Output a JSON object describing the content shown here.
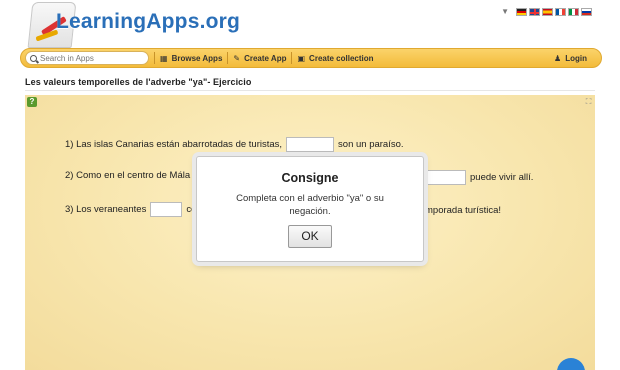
{
  "header": {
    "logo_text": "LearningApps.org",
    "languages": [
      "de",
      "gb",
      "es",
      "fr",
      "it",
      "ru"
    ]
  },
  "navbar": {
    "search_placeholder": "Search in Apps",
    "browse_apps": "Browse Apps",
    "create_app": "Create App",
    "create_collection": "Create collection",
    "login": "Login"
  },
  "page": {
    "title": "Les valeurs temporelles de l'adverbe \"ya\"- Ejercicio"
  },
  "exercise": {
    "line1_before": "1) Las islas Canarias están abarrotadas de turistas,",
    "line1_after": "son un paraíso.",
    "line2_before": "2) Como en el centro de Mála",
    "line2_after": "puede vivir allí.",
    "line3_before": "3) Los veraneantes",
    "line3_mid": "co",
    "line3_after": "mporada turística!"
  },
  "modal": {
    "title": "Consigne",
    "text": "Completa con el adverbio \"ya\" o su negación.",
    "ok_label": "OK"
  },
  "colors": {
    "accent_blue": "#2a6fb8",
    "navbar_orange": "#f3bb3a",
    "app_background": "#f8e6ae"
  }
}
